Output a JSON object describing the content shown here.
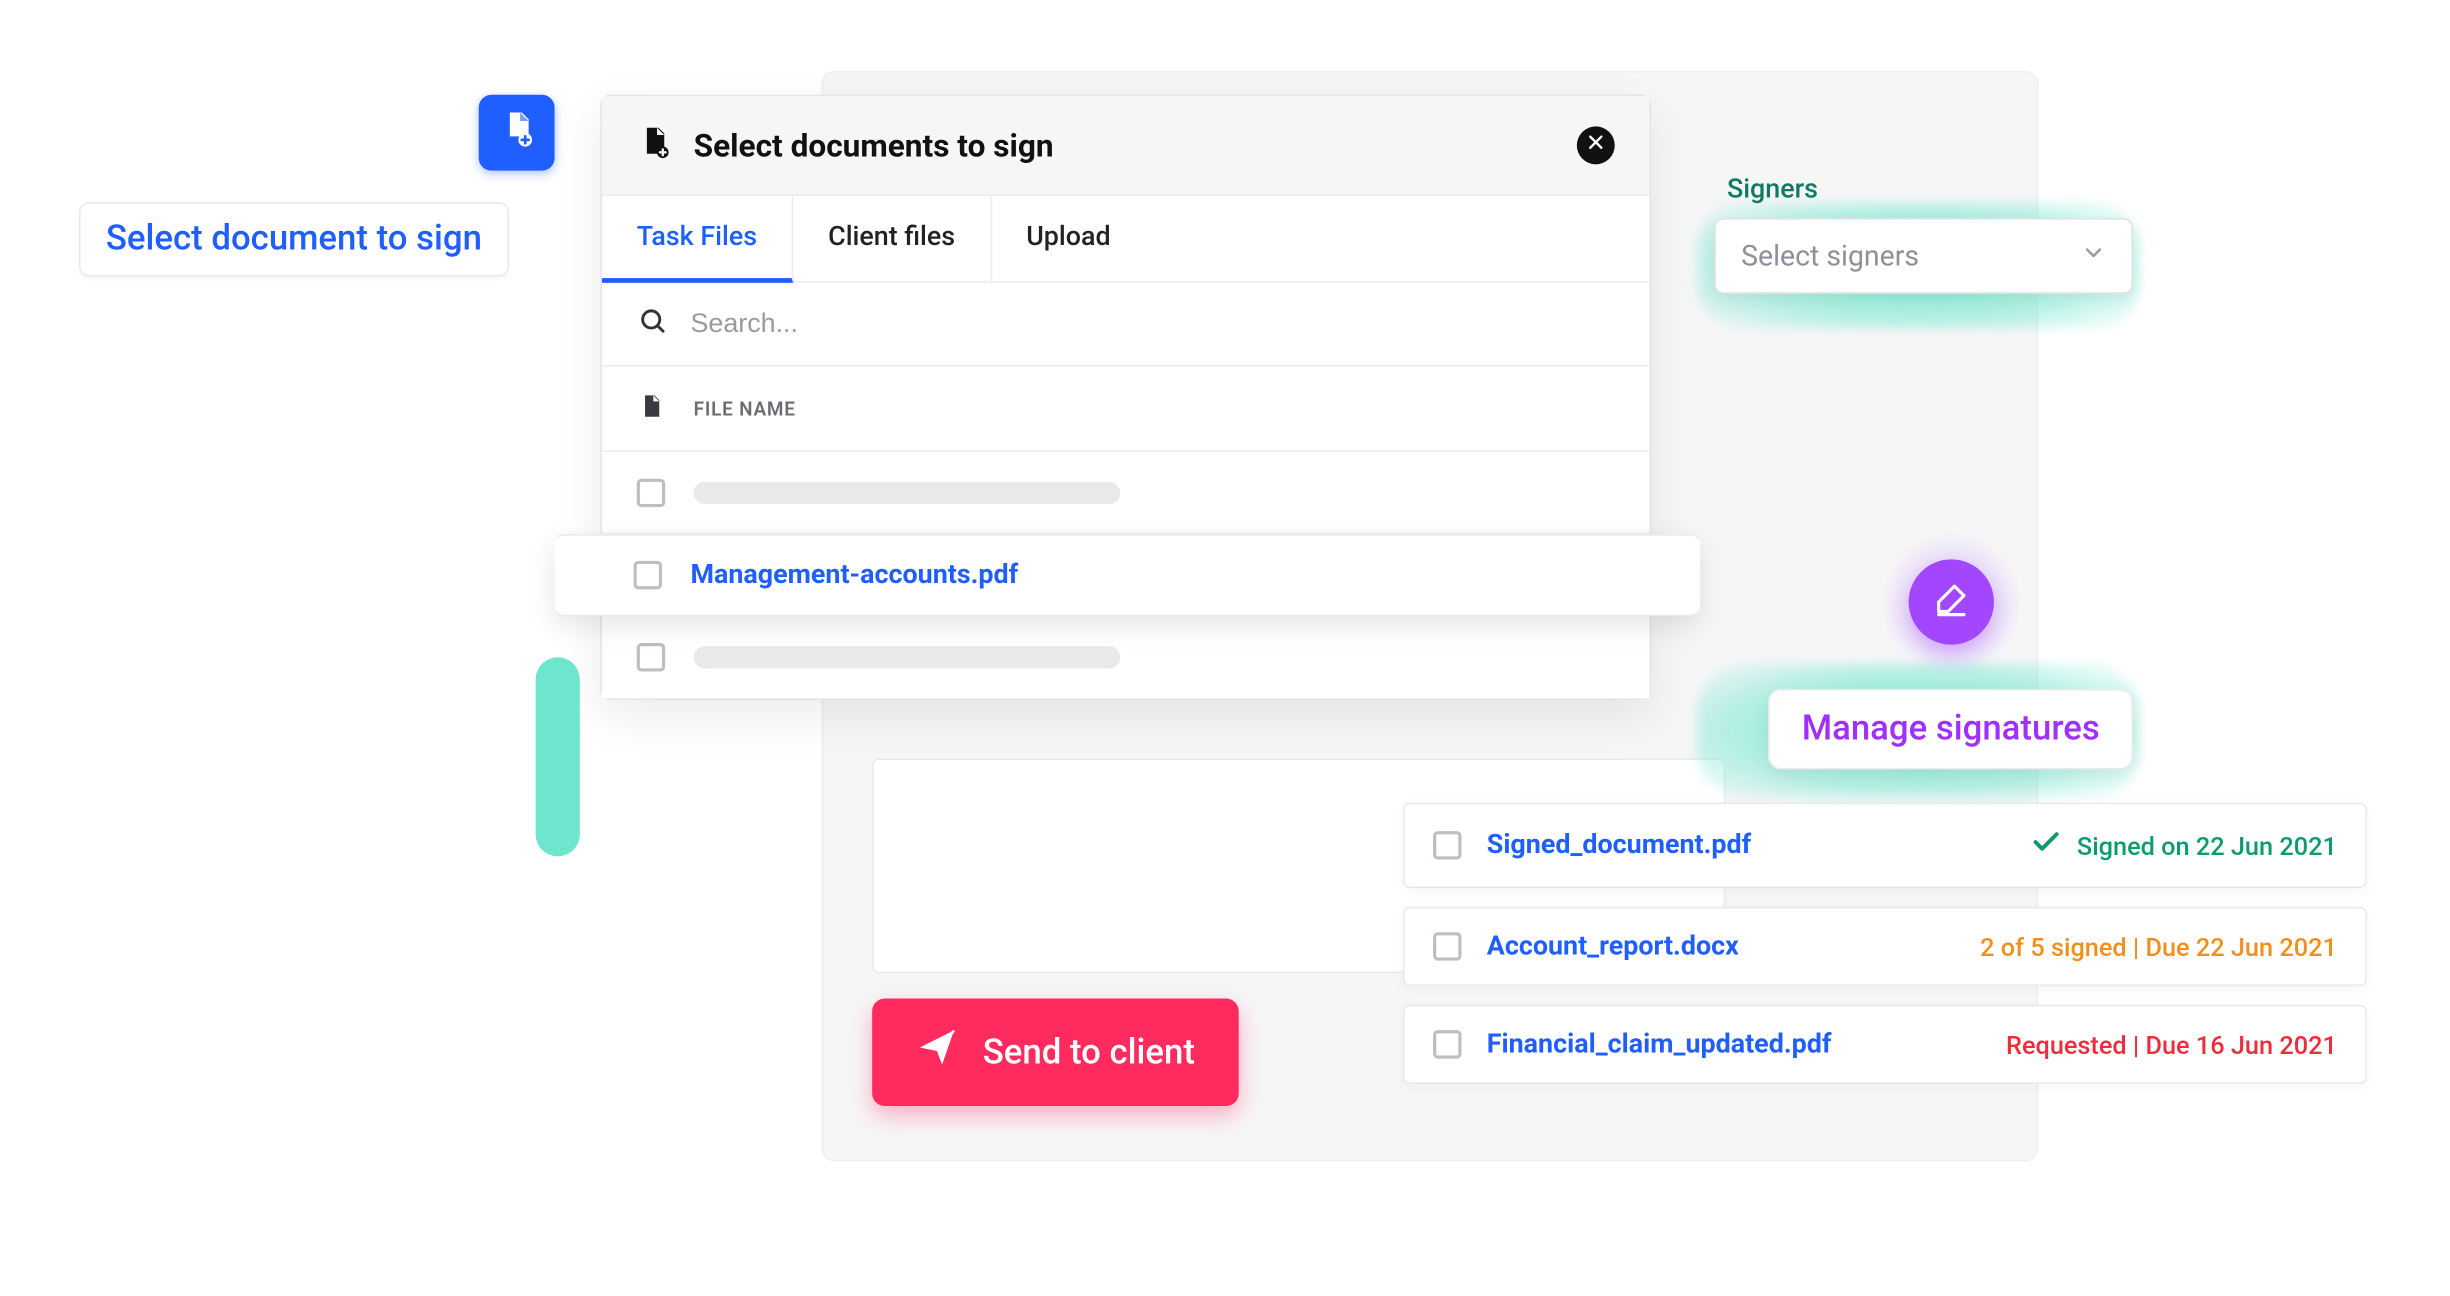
{
  "select_doc_pill": "Select document to sign",
  "modal": {
    "title": "Select documents to sign",
    "tabs": [
      "Task Files",
      "Client files",
      "Upload"
    ],
    "active_tab_index": 0,
    "search_placeholder": "Search...",
    "column_header": "FILE NAME",
    "rows": [
      {
        "checked": false,
        "name": null,
        "highlight": false
      },
      {
        "checked": false,
        "name": "Management-accounts.pdf",
        "highlight": true
      },
      {
        "checked": false,
        "name": null,
        "highlight": false
      }
    ]
  },
  "signers": {
    "label": "Signers",
    "placeholder": "Select signers"
  },
  "manage_signatures_label": "Manage signatures",
  "send_button_label": "Send to client",
  "status_list": [
    {
      "file": "Signed_document.pdf",
      "status": "signed",
      "text": "Signed on 22 Jun 2021"
    },
    {
      "file": "Account_report.docx",
      "status": "partial",
      "text": "2 of 5 signed  | Due 22 Jun 2021"
    },
    {
      "file": "Financial_claim_updated.pdf",
      "status": "requested",
      "text": "Requested  |  Due 16 Jun 2021"
    }
  ],
  "colors": {
    "primary_blue": "#1f5eff",
    "action_pink": "#ff2b5e",
    "violet": "#a347ff",
    "teal": "#55e2c5",
    "status_green": "#0a9c6d",
    "status_amber": "#f0901a",
    "status_red": "#ea2e3e"
  }
}
